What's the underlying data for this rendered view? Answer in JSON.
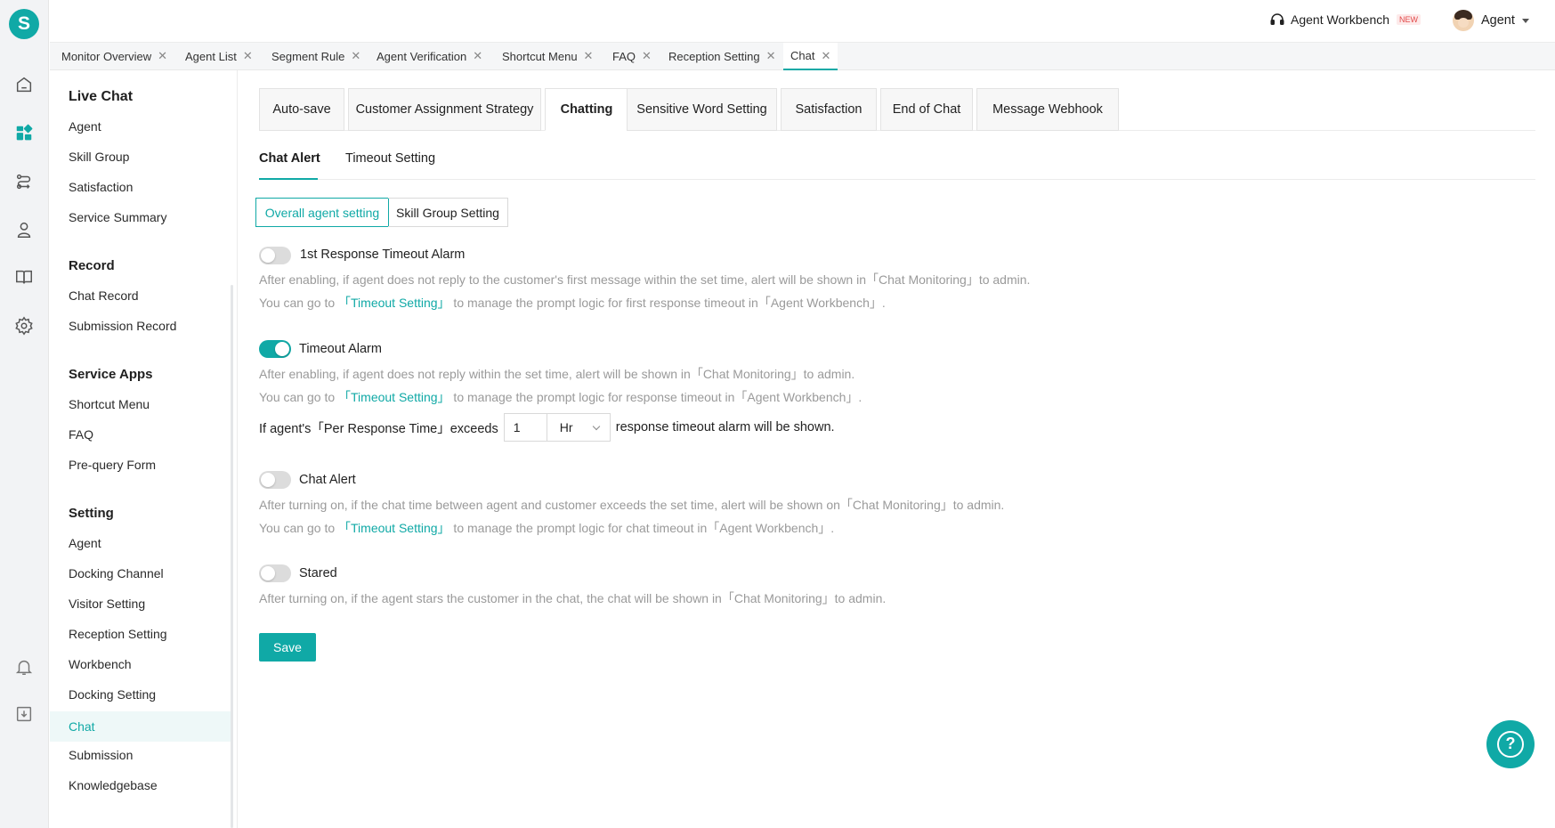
{
  "brand": {
    "logo_letter": "S",
    "accent": "#10a9a6"
  },
  "header": {
    "workbench_label": "Agent Workbench",
    "workbench_badge": "NEW",
    "user_name": "Agent"
  },
  "rail_icons": [
    "home-icon",
    "dashboard-icon",
    "routing-icon",
    "agent-icon",
    "book-icon",
    "gear-icon",
    "bell-icon",
    "download-icon"
  ],
  "page_tabs": [
    {
      "label": "Monitor Overview"
    },
    {
      "label": "Agent List"
    },
    {
      "label": "Segment Rule"
    },
    {
      "label": "Agent Verification"
    },
    {
      "label": "Shortcut Menu"
    },
    {
      "label": "FAQ"
    },
    {
      "label": "Reception Setting"
    },
    {
      "label": "Chat"
    }
  ],
  "sidebar": {
    "live_chat": {
      "title": "Live Chat",
      "items": [
        "Agent",
        "Skill Group",
        "Satisfaction",
        "Service Summary"
      ]
    },
    "record": {
      "title": "Record",
      "items": [
        "Chat Record",
        "Submission Record"
      ]
    },
    "service_apps": {
      "title": "Service Apps",
      "items": [
        "Shortcut Menu",
        "FAQ",
        "Pre-query Form"
      ]
    },
    "setting": {
      "title": "Setting",
      "items": [
        "Agent",
        "Docking Channel",
        "Visitor Setting",
        "Reception Setting",
        "Workbench",
        "Docking Setting",
        "Chat",
        "Submission",
        "Knowledgebase"
      ]
    }
  },
  "top_buttons": [
    "Auto-save",
    "Customer Assignment Strategy",
    "Chatting",
    "Sensitive Word Setting",
    "Satisfaction",
    "End of Chat",
    "Message Webhook"
  ],
  "sub_tabs": [
    "Chat Alert",
    "Timeout Setting"
  ],
  "segments": [
    "Overall agent setting",
    "Skill Group Setting"
  ],
  "options": {
    "first_response": {
      "title": "1st Response Timeout Alarm",
      "enabled": false,
      "desc1": "After enabling, if agent does not reply to the customer's first message within the set time, alert will be shown in「Chat Monitoring」to admin.",
      "desc2_pre": "You can go to ",
      "desc2_link": "「Timeout Setting」",
      "desc2_post": " to manage the prompt logic for first response timeout in「Agent Workbench」."
    },
    "timeout_alarm": {
      "title": "Timeout Alarm",
      "enabled": true,
      "desc1": "After enabling, if agent does not reply within the set time, alert will be shown in「Chat Monitoring」to admin.",
      "desc2_pre": "You can go to ",
      "desc2_link": "「Timeout Setting」",
      "desc2_post": " to manage the prompt logic for response timeout in「Agent Workbench」.",
      "inline_pre": "If agent's「Per Response Time」exceeds",
      "value": "1",
      "unit": "Hr",
      "inline_post": "response timeout alarm will be shown."
    },
    "chat_alert": {
      "title": "Chat Alert",
      "enabled": false,
      "desc1": "After turning on, if the chat time between agent and customer exceeds the set time, alert will be shown on「Chat Monitoring」to admin.",
      "desc2_pre": "You can go to ",
      "desc2_link": "「Timeout Setting」",
      "desc2_post": " to manage the prompt logic for chat timeout in「Agent Workbench」."
    },
    "stared": {
      "title": "Stared",
      "enabled": false,
      "desc1": "After turning on, if the agent stars the customer in the chat, the chat will be shown in「Chat Monitoring」to admin."
    }
  },
  "save_label": "Save",
  "help_label": "?"
}
